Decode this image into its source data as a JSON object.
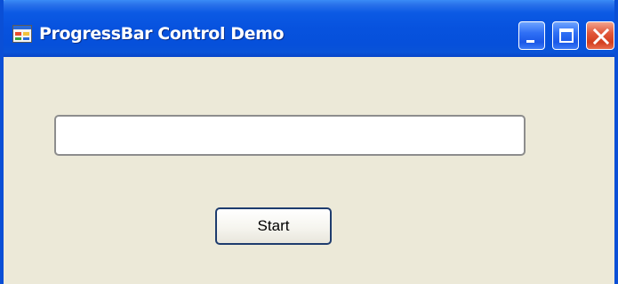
{
  "window": {
    "title": "ProgressBar Control Demo",
    "icon": "application-window-icon",
    "controls": [
      "minimize-icon",
      "maximize-icon",
      "close-icon"
    ]
  },
  "progress_bar": {
    "value_percent": 0
  },
  "start_button": {
    "label": "Start"
  },
  "colors": {
    "titlebar": "#0752de",
    "client_background": "#ece9d8",
    "close_button": "#d23f1f"
  }
}
